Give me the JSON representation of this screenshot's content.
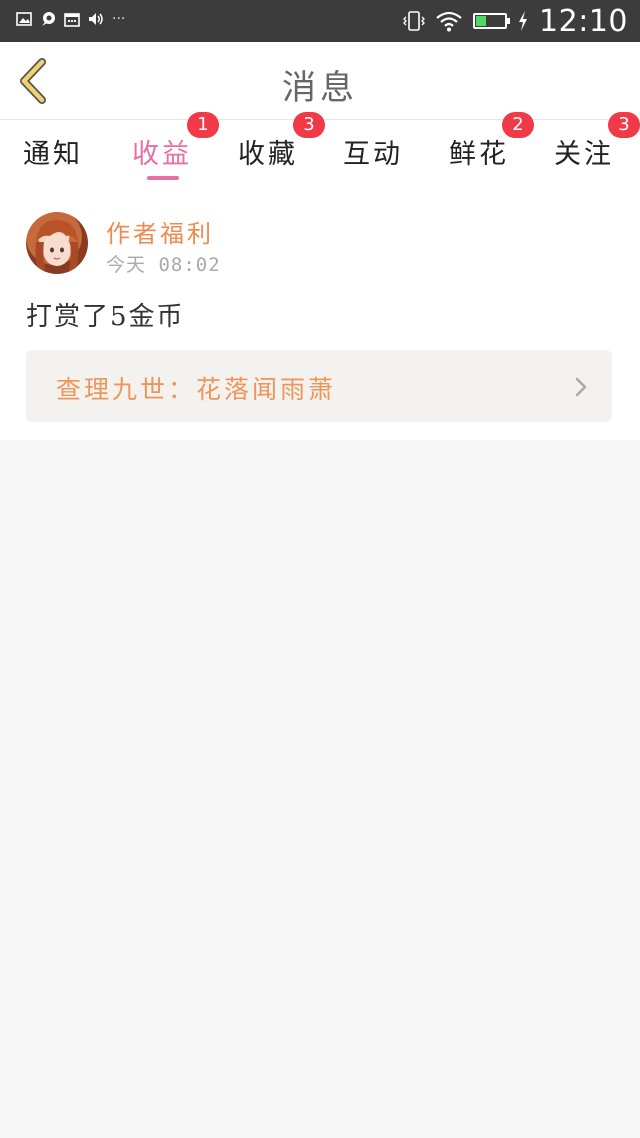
{
  "status_bar": {
    "left_icons": [
      "image-icon",
      "chat-icon",
      "calendar-icon",
      "volume-icon"
    ],
    "dots": "···",
    "right_icons": [
      "vibrate-icon",
      "wifi-icon",
      "battery-icon",
      "charging-icon"
    ],
    "battery_level": 0.35,
    "time": "12:10"
  },
  "header": {
    "title": "消息"
  },
  "tabs": [
    {
      "label": "通知",
      "badge": ""
    },
    {
      "label": "收益",
      "badge": "1",
      "active": true
    },
    {
      "label": "收藏",
      "badge": "3"
    },
    {
      "label": "互动",
      "badge": ""
    },
    {
      "label": "鲜花",
      "badge": "2"
    },
    {
      "label": "关注",
      "badge": "3"
    }
  ],
  "message": {
    "author": "作者福利",
    "time": "今天 08:02",
    "text": "打赏了5金币",
    "book_title": "查理九世：花落闻雨萧"
  },
  "colors": {
    "accent_pink": "#e86ea3",
    "badge_red": "#f03a48",
    "author_orange": "#f08a50",
    "back_yellow": "#f2d36b"
  }
}
